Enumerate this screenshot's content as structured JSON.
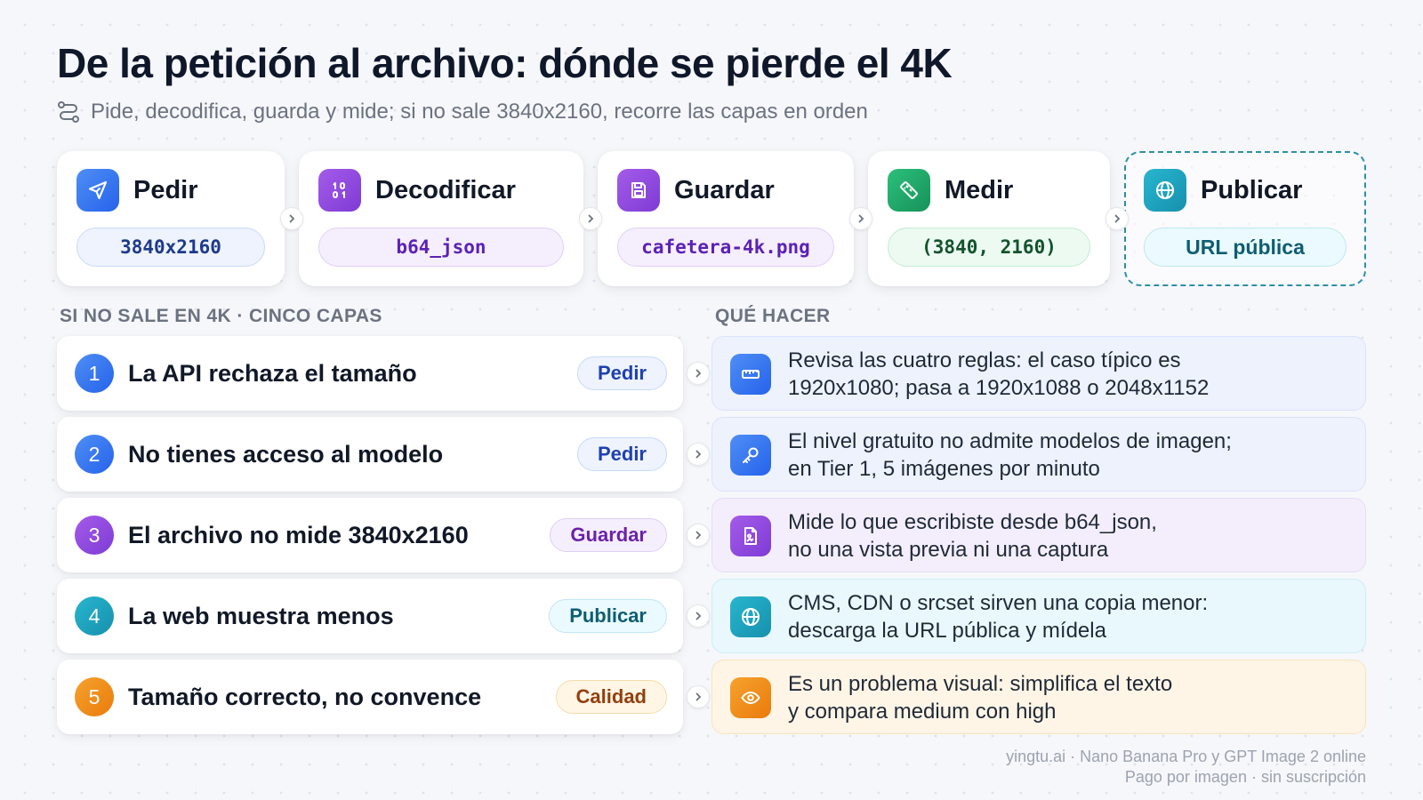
{
  "title": "De la petición al archivo: dónde se pierde el 4K",
  "subtitle": "Pide, decodifica, guarda y mide; si no sale 3840x2160, recorre las capas en orden",
  "pipeline": [
    {
      "name": "Pedir",
      "value": "3840x2160",
      "icon": "send-icon"
    },
    {
      "name": "Decodificar",
      "value": "b64_json",
      "icon": "binary-icon"
    },
    {
      "name": "Guardar",
      "value": "cafetera-4k.png",
      "icon": "save-icon"
    },
    {
      "name": "Medir",
      "value": "(3840, 2160)",
      "icon": "ruler-icon"
    },
    {
      "name": "Publicar",
      "value": "URL pública",
      "icon": "globe-icon"
    }
  ],
  "section_left": "SI NO SALE EN 4K · CINCO CAPAS",
  "section_right": "QUÉ HACER",
  "problems": [
    {
      "number": "1",
      "text": "La API rechaza el tamaño",
      "tag": "Pedir"
    },
    {
      "number": "2",
      "text": "No tienes acceso al modelo",
      "tag": "Pedir"
    },
    {
      "number": "3",
      "text": "El archivo no mide 3840x2160",
      "tag": "Guardar"
    },
    {
      "number": "4",
      "text": "La web muestra menos",
      "tag": "Publicar"
    },
    {
      "number": "5",
      "text": "Tamaño correcto, no convence",
      "tag": "Calidad"
    }
  ],
  "actions": [
    {
      "line1": "Revisa las cuatro reglas: el caso típico es",
      "line2": "1920x1080; pasa a 1920x1088 o 2048x1152",
      "icon": "ruler-icon"
    },
    {
      "line1": "El nivel gratuito no admite modelos de imagen;",
      "line2": "en Tier 1, 5 imágenes por minuto",
      "icon": "key-icon"
    },
    {
      "line1": "Mide lo que escribiste desde b64_json,",
      "line2": "no una vista previa ni una captura",
      "icon": "image-file-icon"
    },
    {
      "line1": "CMS, CDN o srcset sirven una copia menor:",
      "line2": "descarga la URL pública y mídela",
      "icon": "globe-icon"
    },
    {
      "line1": "Es un problema visual: simplifica el texto",
      "line2": "y compara medium con high",
      "icon": "eye-icon"
    }
  ],
  "footer": {
    "line1": "yingtu.ai · Nano Banana Pro y GPT Image 2 online",
    "line2": "Pago por imagen · sin suscripción"
  },
  "colors": {
    "blue": "#2f6fe8",
    "purple": "#8b3fd9",
    "teal": "#1a9fbb",
    "green": "#1faa62",
    "orange": "#f08a0f"
  }
}
